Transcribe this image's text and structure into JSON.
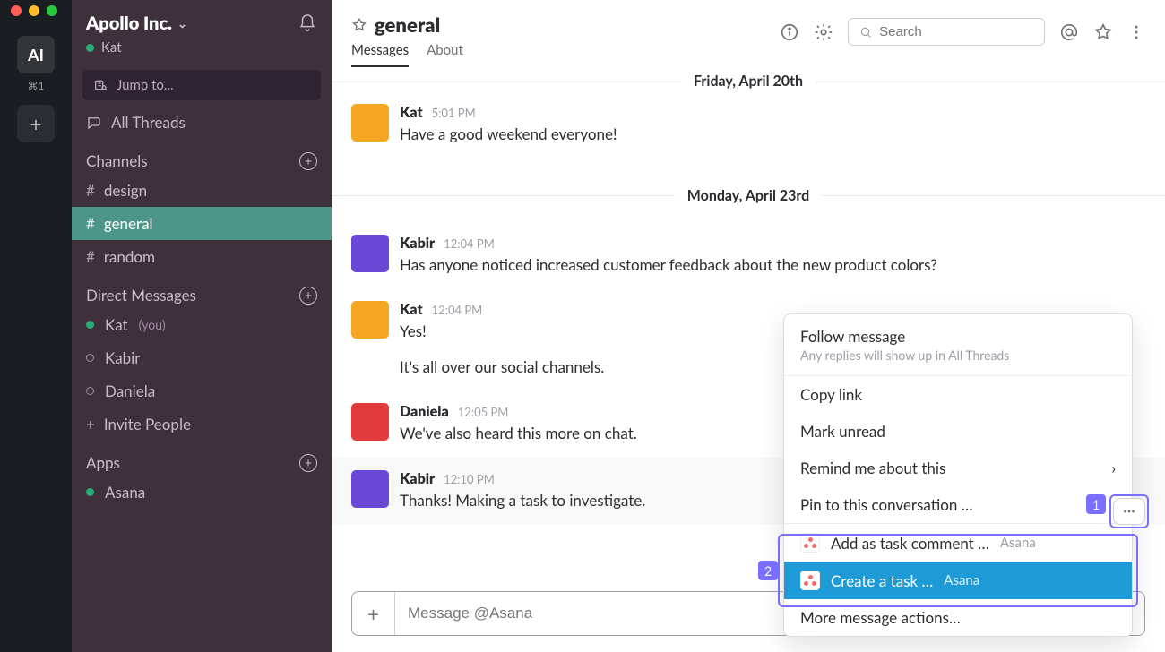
{
  "rail": {
    "workspace_initials": "AI",
    "workspace_shortcut": "⌘1"
  },
  "sidebar": {
    "workspace_name": "Apollo Inc.",
    "current_user": "Kat",
    "jump_placeholder": "Jump to...",
    "all_threads": "All Threads",
    "channels_label": "Channels",
    "channels": [
      {
        "name": "design",
        "active": false
      },
      {
        "name": "general",
        "active": true
      },
      {
        "name": "random",
        "active": false
      }
    ],
    "dms_label": "Direct Messages",
    "dms": [
      {
        "name": "Kat",
        "online": true,
        "you_suffix": "(you)"
      },
      {
        "name": "Kabir",
        "online": false
      },
      {
        "name": "Daniela",
        "online": false
      }
    ],
    "invite_label": "Invite People",
    "apps_label": "Apps",
    "apps": [
      {
        "name": "Asana",
        "online": true
      }
    ]
  },
  "header": {
    "channel_name": "general",
    "tabs": {
      "messages": "Messages",
      "about": "About"
    },
    "search_placeholder": "Search"
  },
  "feed": {
    "dates": {
      "d1": "Friday, April 20th",
      "d2": "Monday, April 23rd"
    },
    "m1": {
      "name": "Kat",
      "time": "5:01 PM",
      "text": "Have a good weekend everyone!"
    },
    "m2": {
      "name": "Kabir",
      "time": "12:04 PM",
      "text": "Has anyone noticed increased customer feedback about the new product colors?"
    },
    "m3": {
      "name": "Kat",
      "time": "12:04 PM",
      "text1": "Yes!",
      "text2": "It's all over our social channels."
    },
    "m4": {
      "name": "Daniela",
      "time": "12:05 PM",
      "text": "We've also heard this more on chat."
    },
    "m5": {
      "name": "Kabir",
      "time": "12:10 PM",
      "text": "Thanks! Making a task to investigate."
    }
  },
  "composer": {
    "placeholder": "Message @Asana"
  },
  "context_menu": {
    "follow_title": "Follow message",
    "follow_sub": "Any replies will show up in All Threads",
    "copy_link": "Copy link",
    "mark_unread": "Mark unread",
    "remind": "Remind me about this",
    "pin": "Pin to this conversation …",
    "add_comment": "Add as task comment …",
    "create_task": "Create a task …",
    "app_name": "Asana",
    "more": "More message actions…"
  },
  "callouts": {
    "one": "1",
    "two": "2"
  },
  "colors": {
    "accent": "#796eff",
    "selection": "#1e9bd7",
    "sidebar_active": "#4C9689"
  },
  "avatars": {
    "kat": "#f5a623",
    "kabir": "#6a47d5",
    "daniela": "#e23b3b"
  }
}
